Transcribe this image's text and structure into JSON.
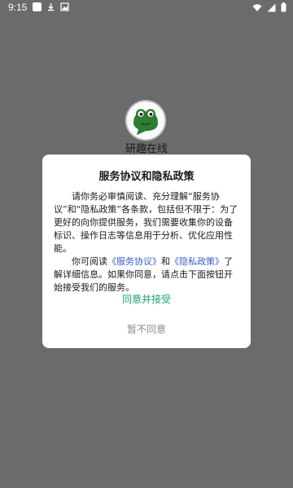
{
  "status_bar": {
    "time": "9:15",
    "left_icons": [
      "app-square-icon",
      "download-icon",
      "image-icon"
    ],
    "right_icons": [
      "wifi-icon",
      "signal-icon",
      "battery-icon"
    ]
  },
  "splash": {
    "app_name": "研趣在线",
    "logo_icon": "frog-logo-icon"
  },
  "dialog": {
    "title": "服务协议和隐私政策",
    "para1": "请你务必审慎阅读、充分理解“服务协议”和“隐私政策”各条款，包括但不限于：为了更好的向你提供服务，我们需要收集你的设备标识、操作日志等信息用于分析、优化应用性能。",
    "para2_prefix": "你可阅读",
    "service_link": "《服务协议》",
    "and_text": "和",
    "privacy_link": "《隐私政策》",
    "para2_suffix": "了解详细信息。如果你同意，请点击下面按钮开始接受我们的服务。",
    "agree_label": "同意并接受",
    "disagree_label": "暂不同意"
  },
  "colors": {
    "overlay": "#6b6b6b",
    "logo_green": "#2e7d32",
    "link": "#3a5bd9",
    "agree": "#1aa36f",
    "disagree": "#8a8a8a"
  }
}
